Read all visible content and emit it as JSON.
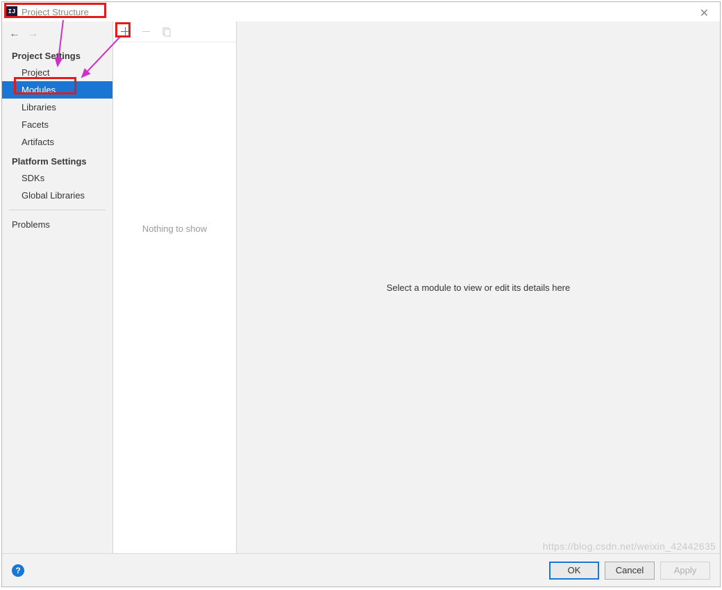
{
  "window": {
    "title": "Project Structure",
    "app_icon_text": "IJ"
  },
  "sidebar": {
    "section_project_settings": "Project Settings",
    "section_platform_settings": "Platform Settings",
    "items_project": [
      {
        "label": "Project",
        "selected": false
      },
      {
        "label": "Modules",
        "selected": true
      },
      {
        "label": "Libraries",
        "selected": false
      },
      {
        "label": "Facets",
        "selected": false
      },
      {
        "label": "Artifacts",
        "selected": false
      }
    ],
    "items_platform": [
      {
        "label": "SDKs"
      },
      {
        "label": "Global Libraries"
      }
    ],
    "item_problems": "Problems"
  },
  "middle": {
    "empty_text": "Nothing to show"
  },
  "content": {
    "placeholder": "Select a module to view or edit its details here"
  },
  "footer": {
    "ok": "OK",
    "cancel": "Cancel",
    "apply": "Apply"
  },
  "watermark": "https://blog.csdn.net/weixin_42442635"
}
